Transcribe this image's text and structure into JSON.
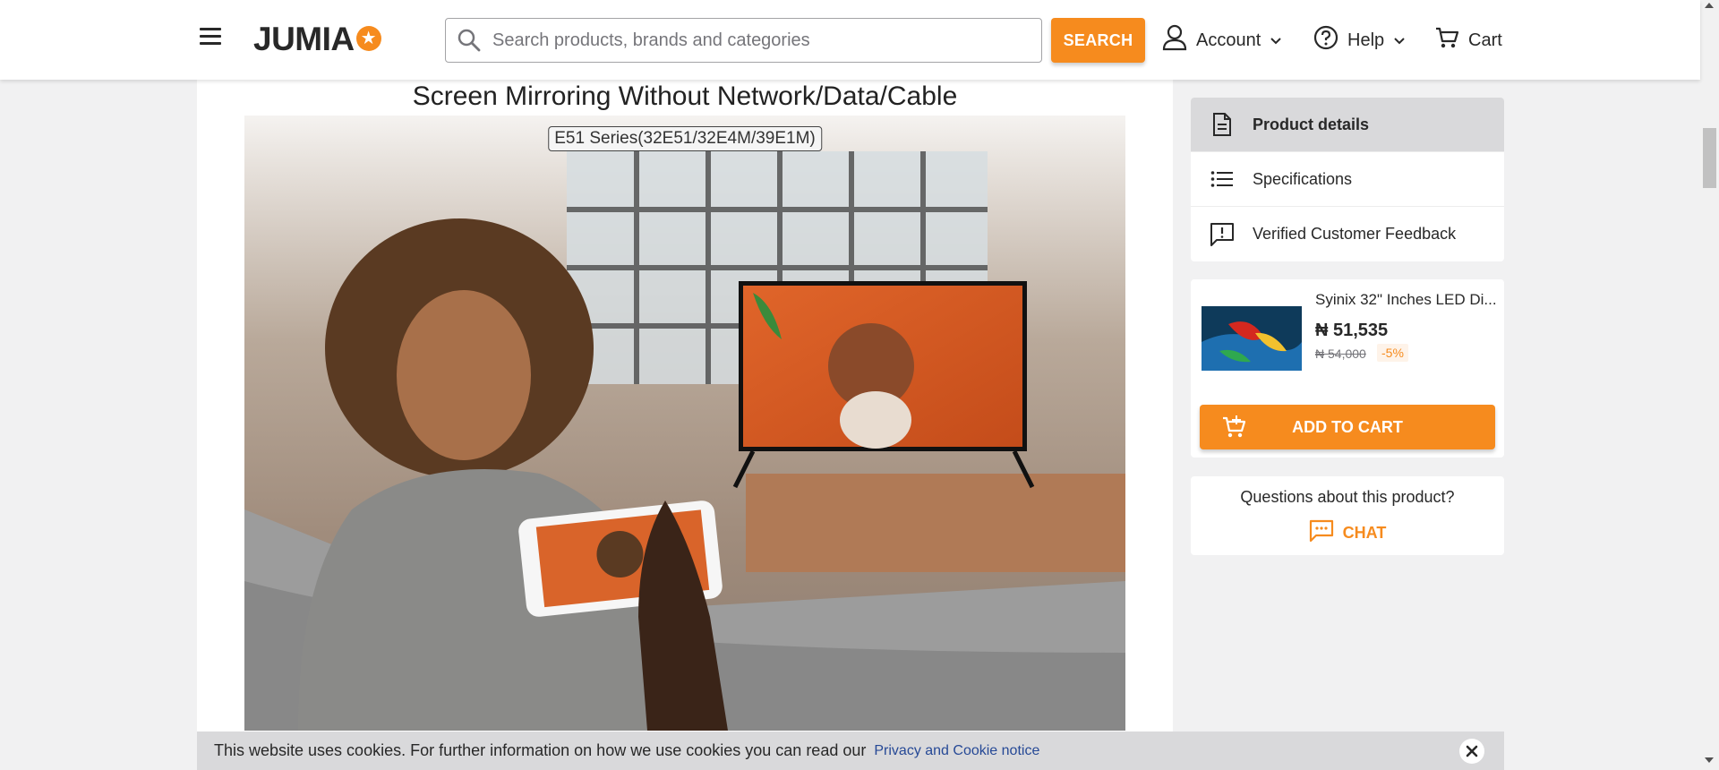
{
  "header": {
    "logo_text": "JUMIA",
    "search_placeholder": "Search products, brands and categories",
    "search_button": "SEARCH",
    "account_label": "Account",
    "help_label": "Help",
    "cart_label": "Cart"
  },
  "hero": {
    "title": "Screen Mirroring Without Network/Data/Cable",
    "badge": "E51 Series(32E51/32E4M/39E1M)"
  },
  "sidebar": {
    "items": [
      {
        "label": "Product details",
        "icon": "document-icon",
        "active": true
      },
      {
        "label": "Specifications",
        "icon": "list-icon",
        "active": false
      },
      {
        "label": "Verified Customer Feedback",
        "icon": "feedback-icon",
        "active": false
      }
    ]
  },
  "product": {
    "name": "Syinix 32\" Inches LED Di...",
    "price": "₦ 51,535",
    "old_price": "₦ 54,000",
    "discount": "-5%",
    "add_to_cart": "ADD TO CART"
  },
  "questions": {
    "text": "Questions about this product?",
    "chat_label": "CHAT"
  },
  "cookie": {
    "text": "This website uses cookies. For further information on how we use cookies you can read our",
    "link": "Privacy and Cookie notice"
  },
  "colors": {
    "accent": "#f68b1e",
    "text": "#282828",
    "link": "#264996"
  }
}
